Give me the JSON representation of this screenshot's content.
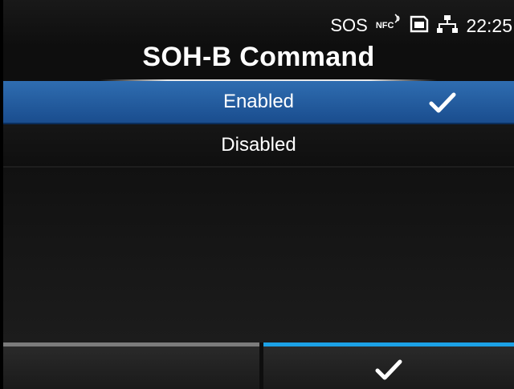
{
  "status": {
    "sos": "SOS",
    "nfc": "NFC",
    "time": "22:25",
    "icons": [
      "nfc-icon",
      "memory-card-icon",
      "network-icon"
    ]
  },
  "title": "SOH-B Command",
  "options": [
    {
      "label": "Enabled",
      "selected": true
    },
    {
      "label": "Disabled",
      "selected": false
    }
  ],
  "footer": {
    "left_label": "",
    "right_icon": "checkmark-icon"
  },
  "colors": {
    "selected": "#2563a8",
    "accent": "#1ca1e6",
    "inactive_bar": "#7c7c7c"
  }
}
